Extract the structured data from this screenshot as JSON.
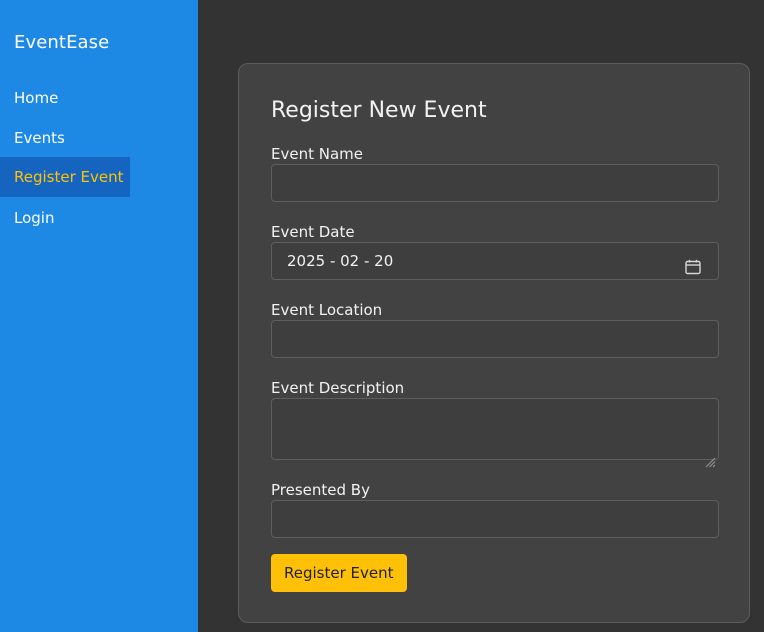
{
  "app": {
    "brand": "EventEase"
  },
  "sidebar": {
    "items": [
      {
        "label": "Home"
      },
      {
        "label": "Events"
      },
      {
        "label": "Register Event"
      },
      {
        "label": "Login"
      }
    ],
    "active_index": 2
  },
  "form": {
    "title": "Register New Event",
    "fields": {
      "event_name": {
        "label": "Event Name",
        "value": ""
      },
      "event_date": {
        "label": "Event Date",
        "value": "2025 - 02 - 20"
      },
      "event_location": {
        "label": "Event Location",
        "value": ""
      },
      "event_description": {
        "label": "Event Description",
        "value": ""
      },
      "presented_by": {
        "label": "Presented By",
        "value": ""
      }
    },
    "submit_label": "Register Event"
  },
  "icons": {
    "date_picker": "calendar-icon",
    "textarea_resize": "resize-grip-icon"
  },
  "colors": {
    "sidebar_bg": "#1e88e5",
    "active_item_bg": "#1565c0",
    "accent": "#ffc107",
    "page_bg": "#333333",
    "card_bg": "#424242"
  }
}
